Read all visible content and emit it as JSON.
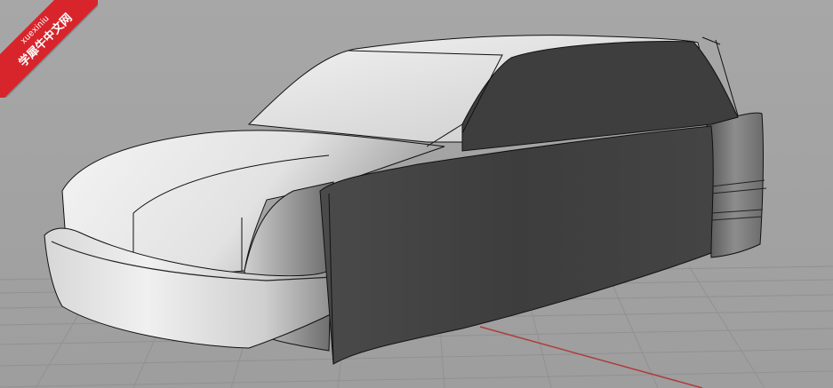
{
  "viewport": {
    "background": "#a5a5a5",
    "model_colors": {
      "light_surface": "#e6e6e6",
      "dark_surface": "#3a3a3a",
      "edge_lines": "#111111",
      "grid": "#8e8e8e",
      "axis_x": "#b03a3a"
    }
  },
  "watermark": {
    "line1": "xuexiniu",
    "line2": "学犀牛中文网",
    "color": "#d8242b"
  }
}
